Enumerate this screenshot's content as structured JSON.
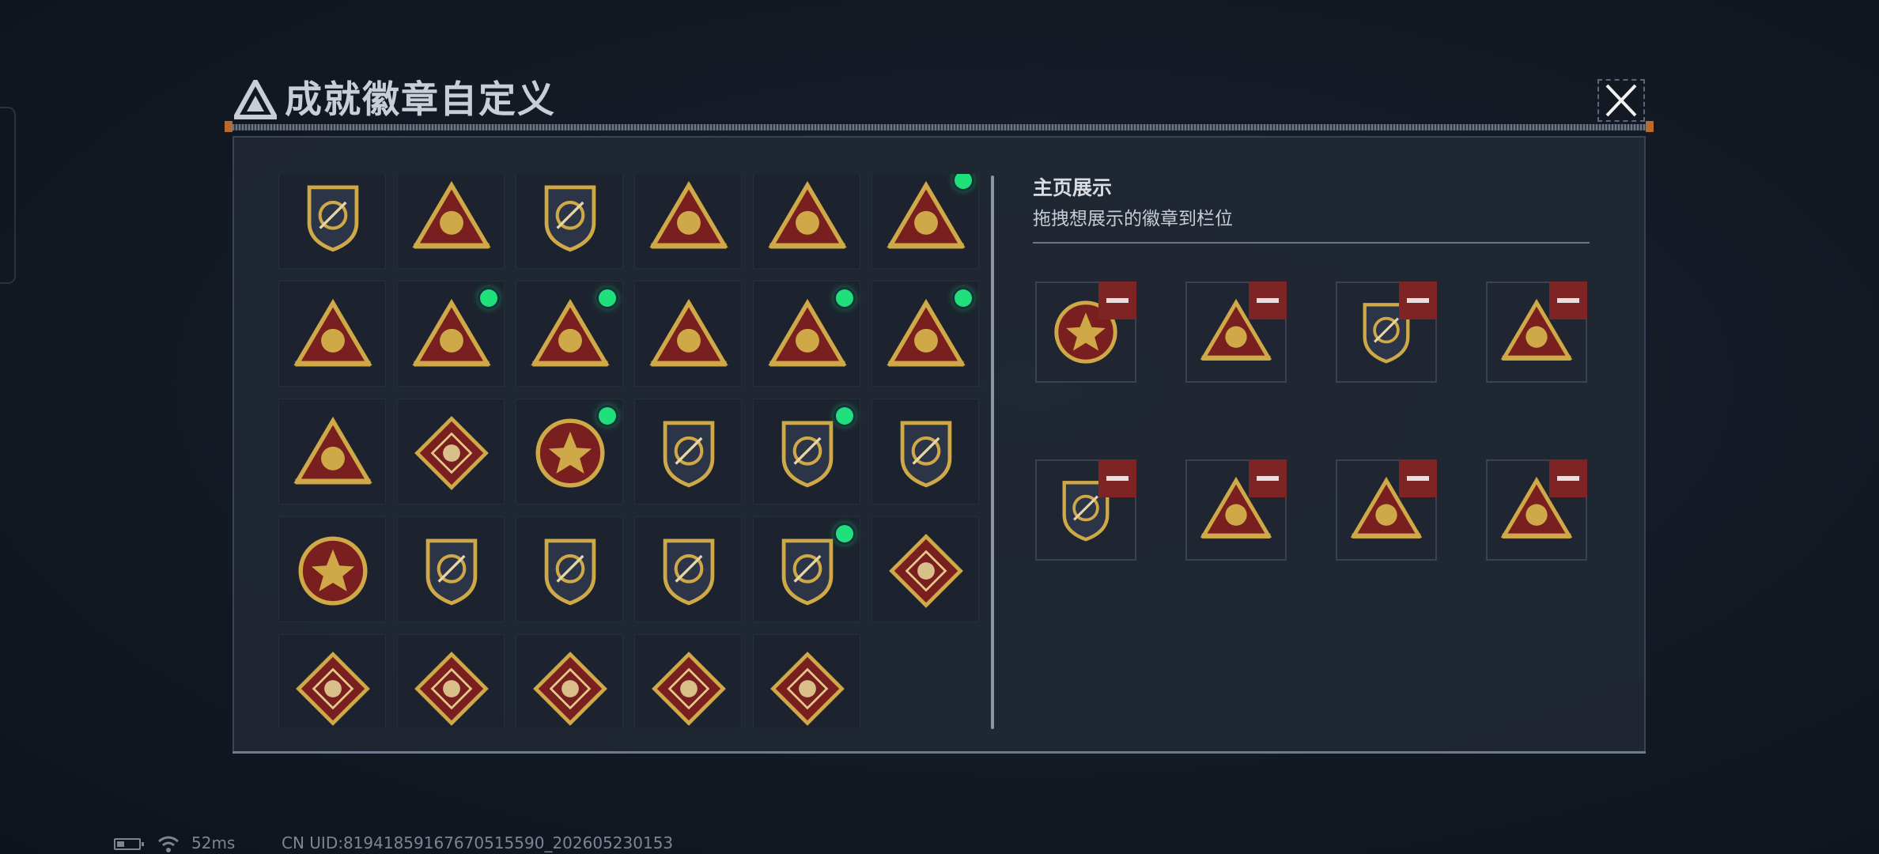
{
  "dialog": {
    "title": "成就徽章自定义",
    "close_icon": "close-x-icon"
  },
  "theme": {
    "gold": "#cfa948",
    "crimson": "#7a1f1f",
    "new_indicator": "#1fe07a",
    "remove_red": "#7f2424"
  },
  "badge_grid": {
    "rows": [
      [
        {
          "icon": "delta-shield-badge",
          "new": false
        },
        {
          "icon": "helicopter-badge",
          "new": false
        },
        {
          "icon": "dagger-shield-badge",
          "new": false
        },
        {
          "icon": "season-s6-badge",
          "new": false
        },
        {
          "icon": "season-s7-badge",
          "new": false
        },
        {
          "icon": "season-s8-badge",
          "new": true
        }
      ],
      [
        {
          "icon": "rock-hand-badge",
          "new": false
        },
        {
          "icon": "trophy-badge",
          "new": true
        },
        {
          "icon": "eggs-nest-badge",
          "new": true
        },
        {
          "icon": "number-one-badge",
          "new": false
        },
        {
          "icon": "usb-drive-badge",
          "new": true
        },
        {
          "icon": "kneeling-soldier-badge",
          "new": true
        }
      ],
      [
        {
          "icon": "soldiers-badge",
          "new": false
        },
        {
          "icon": "rose-diamond-badge",
          "new": false
        },
        {
          "icon": "star-compass-badge",
          "new": true
        },
        {
          "icon": "chevron-shield-badge",
          "new": false
        },
        {
          "icon": "star-crest-badge",
          "new": true
        },
        {
          "icon": "gem-crest-badge",
          "new": false
        }
      ],
      [
        {
          "icon": "skull-emblem-badge",
          "new": false
        },
        {
          "icon": "sniper-crest-badge",
          "new": false
        },
        {
          "icon": "rifle-shield-badge",
          "new": false
        },
        {
          "icon": "blade-shield-badge",
          "new": false
        },
        {
          "icon": "crosshair-crest-badge",
          "new": true
        },
        {
          "icon": "wolf-diamond-badge",
          "new": false
        }
      ],
      [
        {
          "icon": "dragon-diamond-badge",
          "new": false
        },
        {
          "icon": "dragon-diamond-badge-2",
          "new": false
        },
        {
          "icon": "runner-diamond-badge",
          "new": false
        },
        {
          "icon": "horse-diamond-badge",
          "new": false
        },
        {
          "icon": "tools-diamond-badge",
          "new": false
        }
      ]
    ]
  },
  "showcase": {
    "title": "主页展示",
    "subtitle": "拖拽想展示的徽章到栏位",
    "slots": [
      {
        "icon": "star-compass-badge"
      },
      {
        "icon": "kneeling-soldier-badge"
      },
      {
        "icon": "crosshair-crest-badge"
      },
      {
        "icon": "trophy-badge"
      },
      {
        "icon": "star-crest-badge"
      },
      {
        "icon": "season-s8-badge"
      },
      {
        "icon": "usb-drive-badge"
      },
      {
        "icon": "eggs-nest-badge"
      }
    ]
  },
  "status_bar": {
    "battery_icon": "battery-icon",
    "wifi_icon": "wifi-icon",
    "ping": "52ms",
    "uid": "CN UID:81941859167670515590_202605230153"
  }
}
